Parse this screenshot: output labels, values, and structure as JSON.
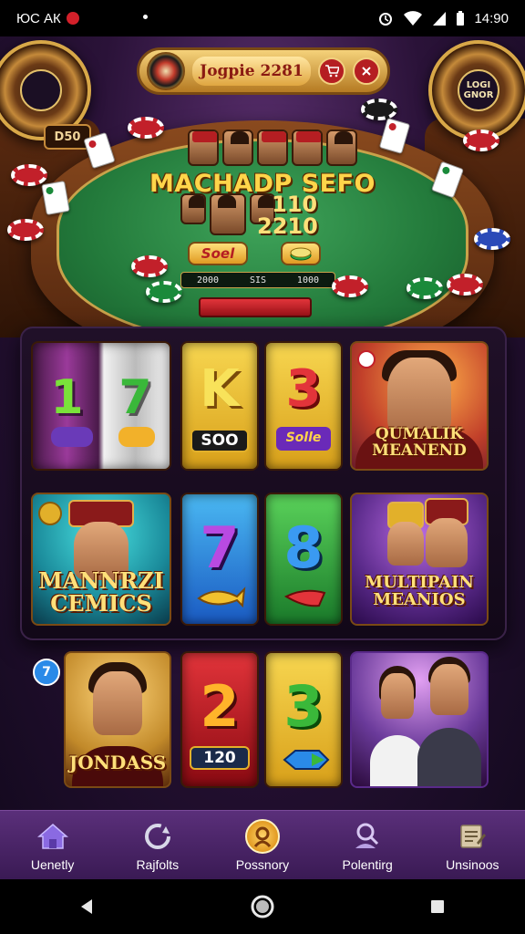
{
  "status_bar": {
    "left_text": "ЮС АК",
    "time": "14:90"
  },
  "table": {
    "top_banner_text": "Jogpie 2281",
    "left_badge": "D50",
    "right_wheel_label": "LOGI GNOR",
    "title": "MACHADP SEFO",
    "value_1": "110",
    "value_2": "2210",
    "start_button": "Soel",
    "score_strip": [
      "2000",
      "SIS",
      "1000"
    ]
  },
  "slot_grid": {
    "row1": [
      {
        "type": "reel",
        "numbers": [
          "1",
          "7"
        ],
        "colors": [
          "#8a2a8a",
          "#e8e8e8"
        ]
      },
      {
        "type": "reel",
        "label": "K",
        "sub": "SOO",
        "color": "#f2c12e"
      },
      {
        "type": "reel",
        "label": "3",
        "sub": "Solle",
        "color": "#f2c12e"
      },
      {
        "type": "promo",
        "caption": "QUMALIK MEANEND",
        "bg": "#c2402a"
      }
    ],
    "row2": [
      {
        "type": "promo",
        "caption": "MANNRZI CEMICS",
        "bg": "#1a8a9a"
      },
      {
        "type": "reel",
        "label": "7",
        "color": "#2a8ae8"
      },
      {
        "type": "reel",
        "label": "8",
        "color": "#3aa84a"
      },
      {
        "type": "promo",
        "caption": "MULTIPAIN MEANIOS",
        "bg": "#5a2a8a"
      }
    ],
    "row3": [
      {
        "type": "promo",
        "caption": "JONDASS",
        "bg": "#c28a2a"
      },
      {
        "type": "reel",
        "label": "2",
        "sub": "120",
        "color": "#c2202a"
      },
      {
        "type": "reel",
        "label": "3",
        "color": "#f2c12e"
      },
      {
        "type": "promo",
        "caption": "",
        "bg": "#4a2a6a"
      }
    ],
    "badge": "7"
  },
  "bottom_nav": [
    {
      "label": "Uenetly",
      "icon": "home-icon"
    },
    {
      "label": "Rajfolts",
      "icon": "refresh-icon"
    },
    {
      "label": "Possnory",
      "icon": "profile-coin-icon",
      "active": true
    },
    {
      "label": "Polentirg",
      "icon": "search-user-icon"
    },
    {
      "label": "Unsinoos",
      "icon": "edit-document-icon"
    }
  ]
}
